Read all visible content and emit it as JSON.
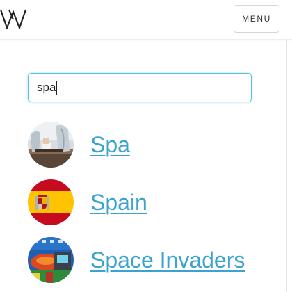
{
  "header": {
    "logo_icon": "w-monogram-logo",
    "menu_label": "MENU"
  },
  "search": {
    "value": "spa"
  },
  "results": [
    {
      "label": "Spa",
      "thumbnail": "spa-photo"
    },
    {
      "label": "Spain",
      "thumbnail": "spain-flag"
    },
    {
      "label": "Space Invaders",
      "thumbnail": "space-invaders-photo"
    }
  ],
  "colors": {
    "link": "#3aa3cf",
    "focus_border": "#5bc0de",
    "flag_red": "#c60b1e",
    "flag_yellow": "#ffc400"
  }
}
